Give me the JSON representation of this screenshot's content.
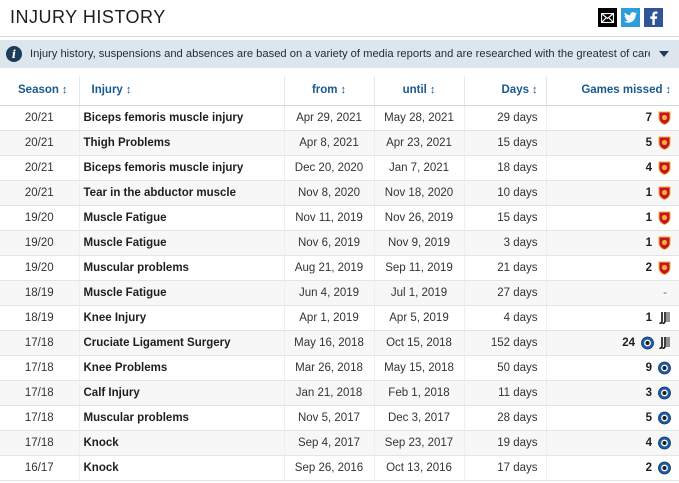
{
  "header": {
    "title": "INJURY HISTORY"
  },
  "share": {
    "mail_icon": "mail-icon",
    "twitter_icon": "twitter-icon",
    "facebook_icon": "facebook-icon"
  },
  "info": {
    "text": "Injury history, suspensions and absences are based on a variety of media reports and are researched with the greatest of care. If you should n..."
  },
  "table": {
    "columns": {
      "season": "Season",
      "injury": "Injury",
      "from": "from",
      "until": "until",
      "days": "Days",
      "games_missed": "Games missed"
    },
    "sort_glyph": "↕",
    "rows": [
      {
        "season": "20/21",
        "injury": "Biceps femoris muscle injury",
        "from": "Apr 29, 2021",
        "until": "May 28, 2021",
        "days": "29 days",
        "games": "7",
        "clubs": [
          "roma"
        ]
      },
      {
        "season": "20/21",
        "injury": "Thigh Problems",
        "from": "Apr 8, 2021",
        "until": "Apr 23, 2021",
        "days": "15 days",
        "games": "5",
        "clubs": [
          "roma"
        ]
      },
      {
        "season": "20/21",
        "injury": "Biceps femoris muscle injury",
        "from": "Dec 20, 2020",
        "until": "Jan 7, 2021",
        "days": "18 days",
        "games": "4",
        "clubs": [
          "roma"
        ]
      },
      {
        "season": "20/21",
        "injury": "Tear in the abductor muscle",
        "from": "Nov 8, 2020",
        "until": "Nov 18, 2020",
        "days": "10 days",
        "games": "1",
        "clubs": [
          "roma"
        ]
      },
      {
        "season": "19/20",
        "injury": "Muscle Fatigue",
        "from": "Nov 11, 2019",
        "until": "Nov 26, 2019",
        "days": "15 days",
        "games": "1",
        "clubs": [
          "roma"
        ]
      },
      {
        "season": "19/20",
        "injury": "Muscle Fatigue",
        "from": "Nov 6, 2019",
        "until": "Nov 9, 2019",
        "days": "3 days",
        "games": "1",
        "clubs": [
          "roma"
        ]
      },
      {
        "season": "19/20",
        "injury": "Muscular problems",
        "from": "Aug 21, 2019",
        "until": "Sep 11, 2019",
        "days": "21 days",
        "games": "2",
        "clubs": [
          "roma"
        ]
      },
      {
        "season": "18/19",
        "injury": "Muscle Fatigue",
        "from": "Jun 4, 2019",
        "until": "Jul 1, 2019",
        "days": "27 days",
        "games": "-",
        "clubs": []
      },
      {
        "season": "18/19",
        "injury": "Knee Injury",
        "from": "Apr 1, 2019",
        "until": "Apr 5, 2019",
        "days": "4 days",
        "games": "1",
        "clubs": [
          "juventus"
        ]
      },
      {
        "season": "17/18",
        "injury": "Cruciate Ligament Surgery",
        "from": "May 16, 2018",
        "until": "Oct 15, 2018",
        "days": "152 days",
        "games": "24",
        "clubs": [
          "atalanta",
          "juventus"
        ]
      },
      {
        "season": "17/18",
        "injury": "Knee Problems",
        "from": "Mar 26, 2018",
        "until": "May 15, 2018",
        "days": "50 days",
        "games": "9",
        "clubs": [
          "atalanta"
        ]
      },
      {
        "season": "17/18",
        "injury": "Calf Injury",
        "from": "Jan 21, 2018",
        "until": "Feb 1, 2018",
        "days": "11 days",
        "games": "3",
        "clubs": [
          "atalanta"
        ]
      },
      {
        "season": "17/18",
        "injury": "Muscular problems",
        "from": "Nov 5, 2017",
        "until": "Dec 3, 2017",
        "days": "28 days",
        "games": "5",
        "clubs": [
          "atalanta"
        ]
      },
      {
        "season": "17/18",
        "injury": "Knock",
        "from": "Sep 4, 2017",
        "until": "Sep 23, 2017",
        "days": "19 days",
        "games": "4",
        "clubs": [
          "atalanta"
        ]
      },
      {
        "season": "16/17",
        "injury": "Knock",
        "from": "Sep 26, 2016",
        "until": "Oct 13, 2016",
        "days": "17 days",
        "games": "2",
        "clubs": [
          "atalanta"
        ]
      }
    ]
  },
  "colors": {
    "header_link": "#1a5a8f",
    "info_bg": "#dde6ed",
    "twitter": "#2d9cdb",
    "facebook": "#2f5597",
    "roma": "#c8102e",
    "roma_gold": "#f2b22c",
    "atalanta": "#1d5ea8"
  }
}
